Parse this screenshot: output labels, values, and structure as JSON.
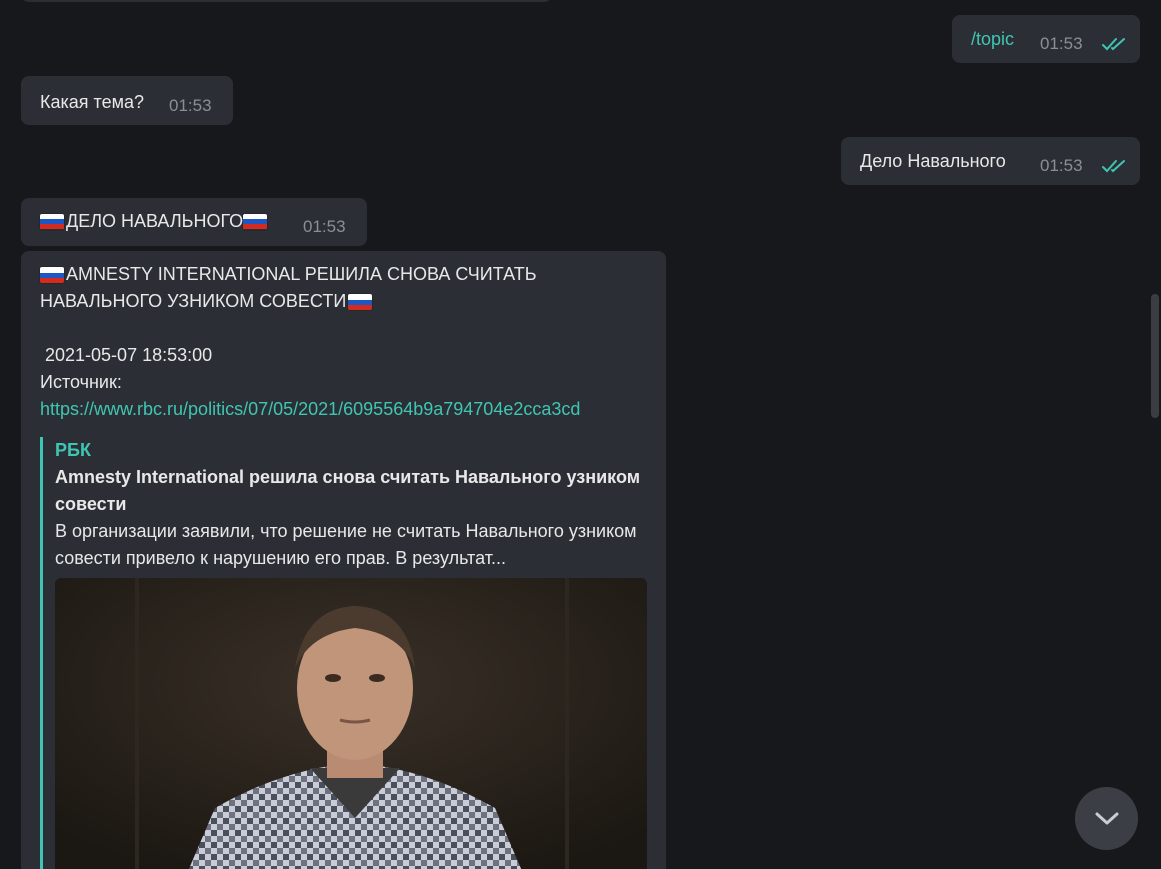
{
  "messages": {
    "topic_cmd": {
      "text": "/topic",
      "time": "01:53"
    },
    "question": {
      "text": "Какая тема?",
      "time": "01:53"
    },
    "answer": {
      "text": "Дело Навального",
      "time": "01:53"
    },
    "header": {
      "text": "ДЕЛО НАВАЛЬНОГО",
      "time": "01:53"
    },
    "news": {
      "title_line1": "AMNESTY INTERNATIONAL РЕШИЛА СНОВА СЧИТАТЬ",
      "title_line2": "НАВАЛЬНОГО УЗНИКОМ СОВЕСТИ",
      "date": "2021-05-07 18:53:00",
      "source_label": "Источник:",
      "link": "https://www.rbc.ru/politics/07/05/2021/6095564b9a794704e2cca3cd",
      "preview": {
        "site": "РБК",
        "title": "Amnesty International решила снова считать Навального узником совести",
        "description": "В организации заявили, что решение не считать Навального узником совести привело к нарушению его прав. В результат..."
      }
    }
  },
  "colors": {
    "background": "#17181c",
    "bubble": "#2b2f35",
    "accent": "#3fc6b3",
    "time": "#8a8f96"
  },
  "icons": {
    "read_receipt": "double-check-icon",
    "flag": "russian-flag-icon",
    "scroll_down": "chevron-down-icon"
  }
}
